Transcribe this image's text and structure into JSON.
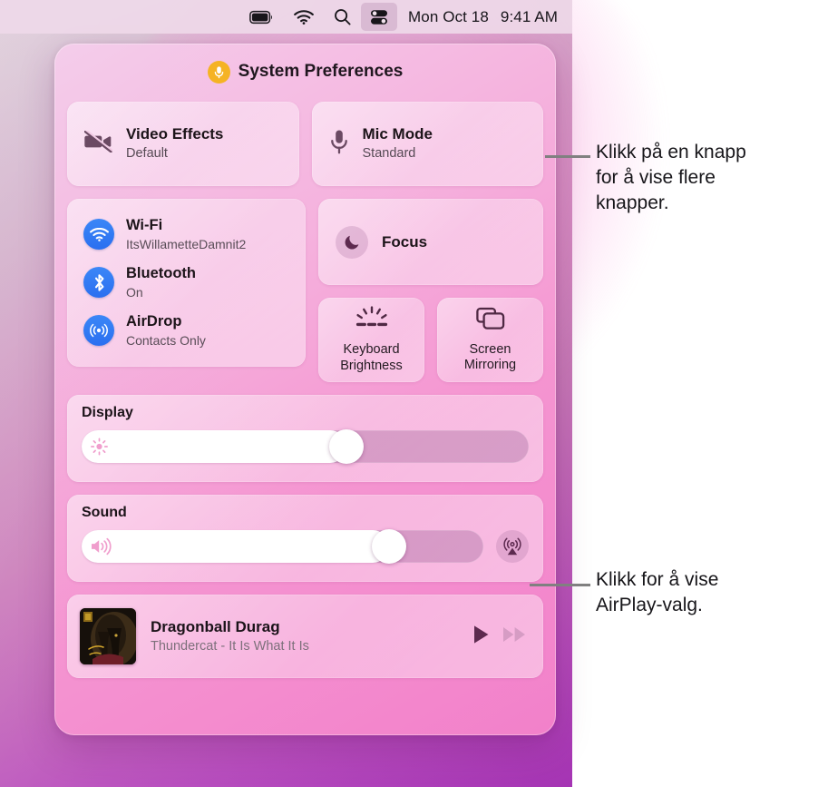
{
  "menubar": {
    "icons": [
      {
        "name": "battery-icon",
        "label": "Battery"
      },
      {
        "name": "wifi-icon",
        "label": "Wi-Fi"
      },
      {
        "name": "search-icon",
        "label": "Spotlight Search"
      },
      {
        "name": "control-center-icon",
        "label": "Control Center"
      }
    ],
    "date": "Mon Oct 18",
    "time": "9:41 AM"
  },
  "panel": {
    "title": "System Preferences",
    "title_icon": "microphone-icon",
    "title_icon_color": "#f5b324"
  },
  "tiles": {
    "video_effects": {
      "icon": "video-camera-off-icon",
      "label": "Video Effects",
      "value": "Default"
    },
    "mic_mode": {
      "icon": "microphone-icon",
      "label": "Mic Mode",
      "value": "Standard"
    },
    "focus": {
      "icon": "moon-icon",
      "label": "Focus"
    },
    "keyboard_brightness": {
      "icon": "keyboard-brightness-icon",
      "label_line1": "Keyboard",
      "label_line2": "Brightness"
    },
    "screen_mirroring": {
      "icon": "screen-mirroring-icon",
      "label_line1": "Screen",
      "label_line2": "Mirroring"
    }
  },
  "network": {
    "accent_color": "#2a6ff0",
    "items": [
      {
        "icon": "wifi-icon",
        "label": "Wi-Fi",
        "value": "ItsWillametteDamnit2"
      },
      {
        "icon": "bluetooth-icon",
        "label": "Bluetooth",
        "value": "On"
      },
      {
        "icon": "airdrop-icon",
        "label": "AirDrop",
        "value": "Contacts Only"
      }
    ]
  },
  "display": {
    "title": "Display",
    "icon": "brightness-icon",
    "percent": 60
  },
  "sound": {
    "title": "Sound",
    "icon": "speaker-volume-icon",
    "percent": 79,
    "airplay_icon": "airplay-audio-icon"
  },
  "now_playing": {
    "title": "Dragonball Durag",
    "subtitle": "Thundercat - It Is What It Is",
    "artwork": "album-artwork",
    "play_icon": "play-icon",
    "next_icon": "fast-forward-icon"
  },
  "callouts": [
    {
      "name": "callout-buttons",
      "lines": [
        "Klikk på en knapp",
        "for å vise flere",
        "knapper."
      ]
    },
    {
      "name": "callout-airplay",
      "lines": [
        "Klikk for å vise",
        "AirPlay-valg."
      ]
    }
  ]
}
